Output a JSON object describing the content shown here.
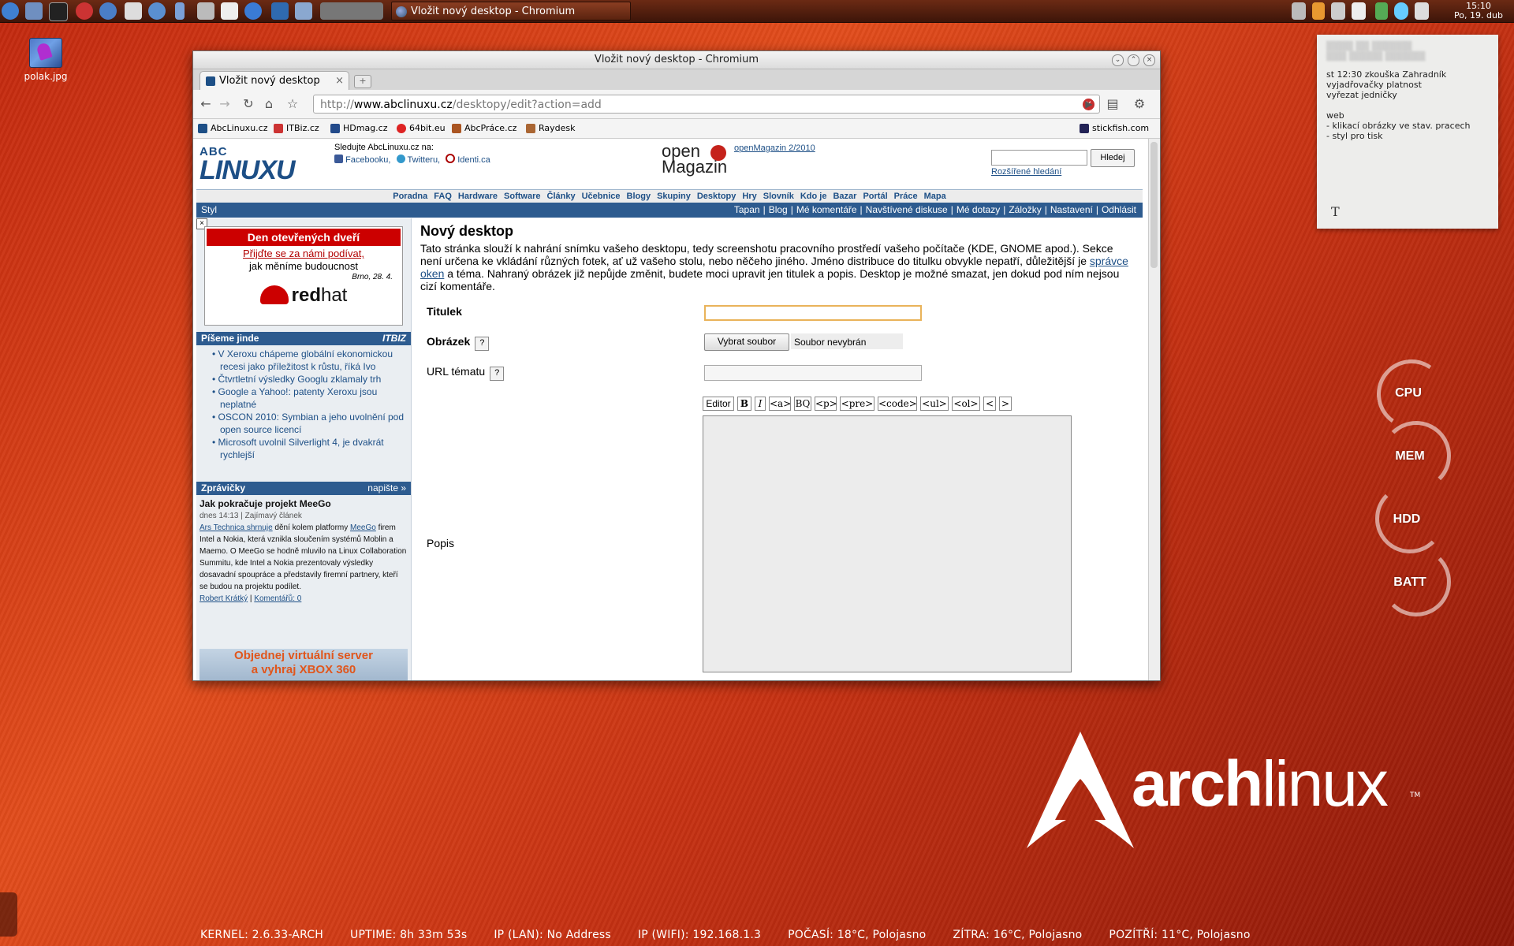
{
  "taskbar": {
    "task_title": "Vložit nový desktop - Chromium",
    "clock_time": "15:10",
    "clock_date": "Po, 19. dub"
  },
  "desktop": {
    "icon_label": "polak.jpg",
    "note": {
      "lines": [
        "st 12:30 zkouška Zahradník",
        "vyjadřovačky platnost",
        "vyřezat jedničky",
        "",
        "web",
        "- klikací obrázky ve stav. pracech",
        "- styl pro tisk"
      ],
      "tool_glyph": "T"
    },
    "meters": [
      "CPU",
      "MEM",
      "HDD",
      "BATT"
    ],
    "arch_logo": {
      "bold": "arch",
      "light": "linux",
      "tm": "TM"
    },
    "statusbar": [
      "KERNEL: 2.6.33-ARCH",
      "UPTIME: 8h 33m 53s",
      "IP (LAN): No Address",
      "IP (WIFI): 192.168.1.3",
      "POČASÍ: 18°C, Polojasno",
      "ZÍTRA: 16°C, Polojasno",
      "POZÍTŘÍ: 11°C, Polojasno"
    ]
  },
  "browser": {
    "window_title": "Vložit nový desktop - Chromium",
    "tab_title": "Vložit nový desktop",
    "url_prefix": "http://",
    "url_host": "www.abclinuxu.cz",
    "url_path": "/desktopy/edit?action=add",
    "bookmarks": [
      "AbcLinuxu.cz",
      "ITBiz.cz",
      "HDmag.cz",
      "64bit.eu",
      "AbcPráce.cz",
      "Raydesk",
      "stickfish.com"
    ]
  },
  "page": {
    "logo_top": "ABC",
    "logo_bottom": "LINUXU",
    "follow_title": "Sledujte AbcLinuxu.cz na:",
    "follow_links": [
      "Facebooku,",
      "Twitteru,",
      "Identi.ca"
    ],
    "openmag_line1": "open",
    "openmag_line2": "Magazin",
    "openmag_link": "openMagazin 2/2010",
    "search_button": "Hledej",
    "advanced_search": "Rozšířené hledání",
    "menu": [
      "Poradna",
      "FAQ",
      "Hardware",
      "Software",
      "Články",
      "Učebnice",
      "Blogy",
      "Skupiny",
      "Desktopy",
      "Hry",
      "Slovník",
      "Kdo je",
      "Bazar",
      "Portál",
      "Práce",
      "Mapa"
    ],
    "style_label": "Styl",
    "user_menu": [
      "Tapan",
      "|",
      "Blog",
      "|",
      "Mé komentáře",
      "|",
      "Navštívené diskuse",
      "|",
      "Mé dotazy",
      "|",
      "Záložky",
      "|",
      "Nastavení",
      "|",
      "Odhlásit"
    ],
    "ad1": {
      "close": "×",
      "head": "Den otevřených dveří",
      "line1": "Přijďte se za námi podívat,",
      "line2": "jak měníme budoucnost",
      "date": "Brno, 28. 4.",
      "brand_bold": "red",
      "brand_light": "hat"
    },
    "jinde_title": "Píšeme jinde",
    "jinde_brand": "ITBIZ",
    "jinde_items": [
      "V Xeroxu chápeme globální ekonomickou recesi jako příležitost k růstu, říká Ivo",
      "Čtvrtletní výsledky Googlu zklamaly trh",
      "Google a Yahoo!: patenty Xeroxu jsou neplatné",
      "OSCON 2010: Symbian a jeho uvolnění pod open source licencí",
      "Microsoft uvolnil Silverlight 4, je dvakrát rychlejší"
    ],
    "news_title": "Zprávičky",
    "news_write": "napište »",
    "news": {
      "title": "Jak pokračuje projekt MeeGo",
      "meta": "dnes 14:13 | Zajímavý článek",
      "link1": "Ars Technica shrnuje",
      "text1": " dění kolem platformy ",
      "link2": "MeeGo",
      "text2": " firem Intel a Nokia, která vznikla sloučením systémů Moblin a Maemo. O MeeGo se hodně mluvilo na Linux Collaboration Summitu, kde Intel a Nokia prezentovaly výsledky dosavadní spoupráce a představily firemní partnery, kteří se budou na projektu podílet.",
      "author": "Robert Krátký",
      "sep": " | ",
      "comments": "Komentářů: 0"
    },
    "ad2_line1": "Objednej virtuální server",
    "ad2_line2": "a vyhraj XBOX 360",
    "heading": "Nový desktop",
    "intro_1": "Tato stránka slouží k nahrání snímku vašeho desktopu, tedy screenshotu pracovního prostředí vašeho počítače (KDE, GNOME apod.). Sekce není určena ke vkládání různých fotek, ať už vašeho stolu, nebo něčeho jiného. Jméno distribuce do titulku obvykle nepatří, důležitější je ",
    "intro_link": "správce oken",
    "intro_2": " a téma. Nahraný obrázek již nepůjde změnit, budete moci upravit jen titulek a popis. Desktop je možné smazat, jen dokud pod ním nejsou cizí komentáře.",
    "form": {
      "titulek_label": "Titulek",
      "obrazek_label": "Obrázek",
      "help": "?",
      "choose_file": "Vybrat soubor",
      "no_file": "Soubor nevybrán",
      "url_label": "URL tématu",
      "popis_label": "Popis",
      "editor_buttons": [
        "Editor",
        "B",
        "I",
        "<a>",
        "BQ",
        "<p>",
        "<pre>",
        "<code>",
        "<ul>",
        "<ol>",
        "<",
        ">"
      ]
    }
  }
}
